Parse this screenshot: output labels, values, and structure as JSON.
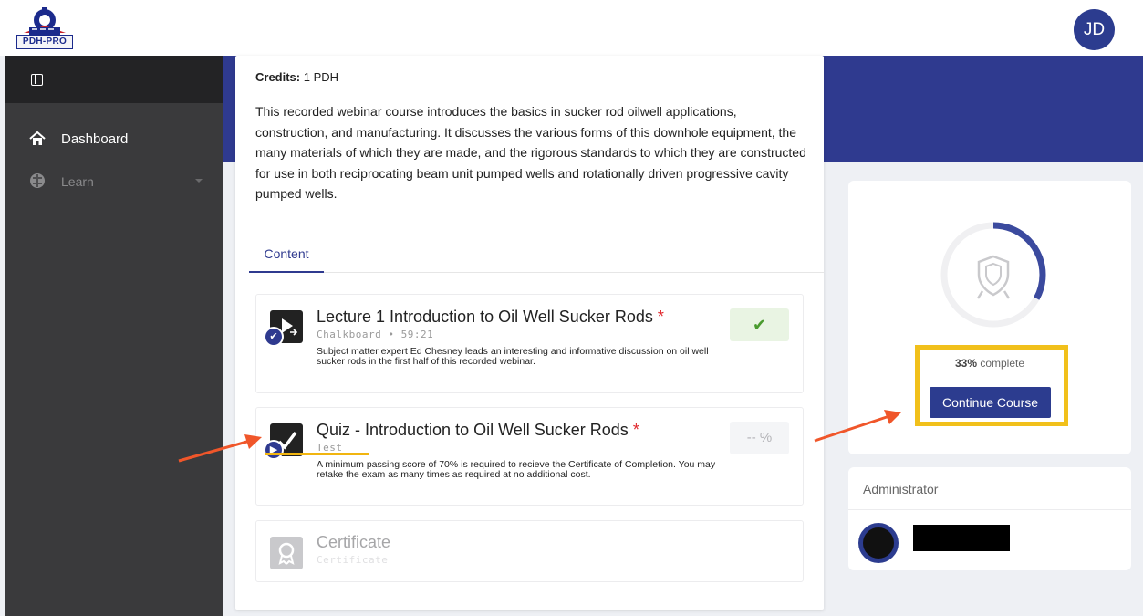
{
  "header": {
    "logo_text": "PDH-PRO",
    "user_initials": "JD"
  },
  "sidebar": {
    "items": [
      {
        "label": "Dashboard",
        "icon": "home-icon"
      },
      {
        "label": "Learn",
        "icon": "brain-icon"
      }
    ]
  },
  "course": {
    "credits_label": "Credits:",
    "credits_value": "1 PDH",
    "description": "This recorded webinar course introduces the basics in sucker rod oilwell applications, construction, and manufacturing. It discusses the various forms of this downhole equipment, the many materials of which they are made, and the rigorous standards to which they are constructed for use in both reciprocating beam unit pumped wells and rotationally driven progressive cavity pumped wells.",
    "tabs": [
      {
        "label": "Content"
      }
    ],
    "items": [
      {
        "title": "Lecture 1 Introduction to Oil Well Sucker Rods",
        "required_mark": "*",
        "subtitle": "Chalkboard • 59:21",
        "description": "Subject matter expert Ed Chesney leads an interesting and informative discussion on oil well sucker rods in the first half of this recorded webinar.",
        "status": "✔"
      },
      {
        "title": "Quiz - Introduction to Oil Well Sucker Rods",
        "required_mark": "*",
        "subtitle": "Test",
        "description": "A minimum passing score of 70% is required to recieve the Certificate of Completion. You may retake the exam as many times as required at no additional cost.",
        "status": "-- %"
      },
      {
        "title": "Certificate",
        "subtitle": "Certificate"
      }
    ]
  },
  "progress": {
    "percent_value": "33%",
    "percent_suffix": " complete",
    "fraction": 0.33,
    "continue_label": "Continue Course"
  },
  "admin": {
    "title": "Administrator"
  },
  "colors": {
    "brand_blue": "#2f3a8f",
    "highlight_yellow": "#f1c01b",
    "arrow_orange": "#f0562a",
    "success_green": "#4a9b2f",
    "required_red": "#e0262b"
  }
}
